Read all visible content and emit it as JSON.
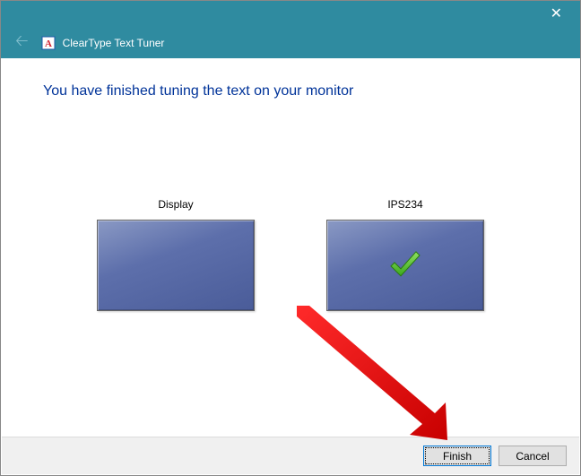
{
  "window": {
    "title": "ClearType Text Tuner"
  },
  "content": {
    "heading": "You have finished tuning the text on your monitor",
    "displays": [
      {
        "label": "Display",
        "checked": false
      },
      {
        "label": "IPS234",
        "checked": true
      }
    ]
  },
  "footer": {
    "finish_label": "Finish",
    "cancel_label": "Cancel"
  }
}
